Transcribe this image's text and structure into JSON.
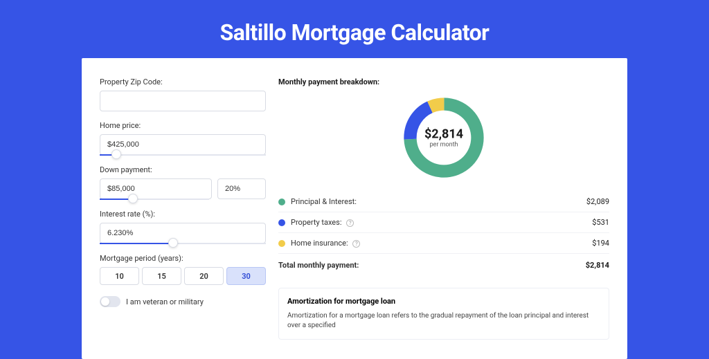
{
  "title": "Saltillo Mortgage Calculator",
  "colors": {
    "principal": "#4fae8b",
    "taxes": "#3654e6",
    "insurance": "#f2cc4a"
  },
  "form": {
    "zip": {
      "label": "Property Zip Code:",
      "value": ""
    },
    "price": {
      "label": "Home price:",
      "value": "$425,000",
      "slider_pct": 10
    },
    "down": {
      "label": "Down payment:",
      "value": "$85,000",
      "pct": "20%",
      "slider_pct": 30
    },
    "rate": {
      "label": "Interest rate (%):",
      "value": "6.230%",
      "slider_pct": 44
    },
    "period": {
      "label": "Mortgage period (years):",
      "options": [
        "10",
        "15",
        "20",
        "30"
      ],
      "selected": "30"
    },
    "veteran": {
      "label": "I am veteran or military",
      "on": false
    }
  },
  "breakdown": {
    "title": "Monthly payment breakdown:",
    "center_amount": "$2,814",
    "center_sub": "per month",
    "items": [
      {
        "label": "Principal & Interest:",
        "value": "$2,089",
        "color": "#4fae8b",
        "info": false
      },
      {
        "label": "Property taxes:",
        "value": "$531",
        "color": "#3654e6",
        "info": true
      },
      {
        "label": "Home insurance:",
        "value": "$194",
        "color": "#f2cc4a",
        "info": true
      }
    ],
    "total_label": "Total monthly payment:",
    "total_value": "$2,814"
  },
  "chart_data": {
    "type": "pie",
    "title": "Monthly payment breakdown",
    "categories": [
      "Principal & Interest",
      "Property taxes",
      "Home insurance"
    ],
    "values": [
      2089,
      531,
      194
    ],
    "colors": [
      "#4fae8b",
      "#3654e6",
      "#f2cc4a"
    ],
    "total": 2814
  },
  "amort": {
    "title": "Amortization for mortgage loan",
    "body": "Amortization for a mortgage loan refers to the gradual repayment of the loan principal and interest over a specified"
  }
}
